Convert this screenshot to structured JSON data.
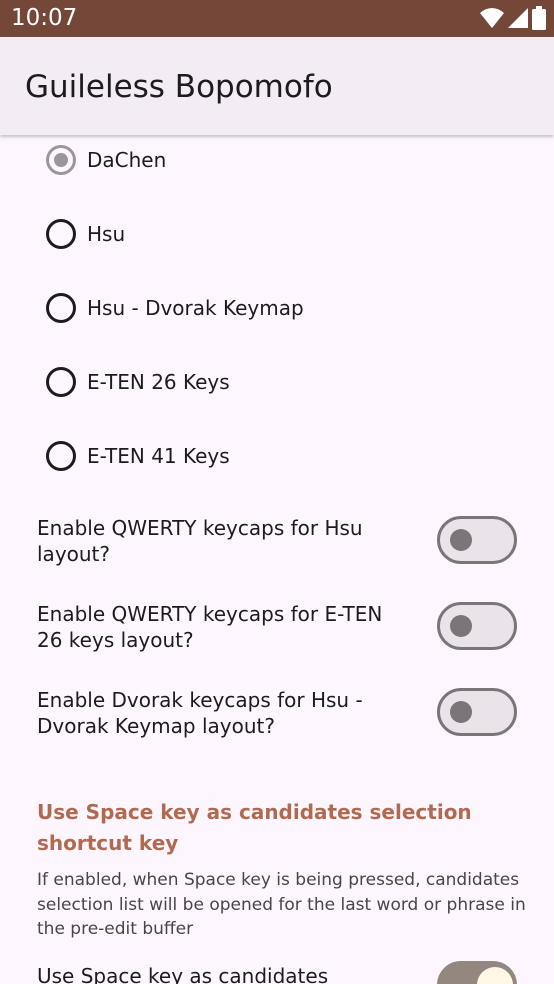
{
  "status_bar": {
    "time": "10:07",
    "icons": [
      "wifi-icon",
      "cellular-icon",
      "battery-icon"
    ]
  },
  "app_bar": {
    "title": "Guileless Bopomofo"
  },
  "keyboard_layouts": {
    "options": [
      {
        "label": "DaChen",
        "selected": true
      },
      {
        "label": "Hsu",
        "selected": false
      },
      {
        "label": "Hsu - Dvorak Keymap",
        "selected": false
      },
      {
        "label": "E-TEN 26 Keys",
        "selected": false
      },
      {
        "label": "E-TEN 41 Keys",
        "selected": false
      }
    ]
  },
  "switches": [
    {
      "label": "Enable QWERTY keycaps for Hsu layout?",
      "on": false
    },
    {
      "label": "Enable QWERTY keycaps for E-TEN 26 keys layout?",
      "on": false
    },
    {
      "label": "Enable Dvorak keycaps for Hsu - Dvorak Keymap layout?",
      "on": false
    }
  ],
  "space_key_section": {
    "title": "Use Space key as candidates selection shortcut key",
    "summary": "If enabled, when Space key is being pressed, candidates selection list will be opened for the last word or phrase in the pre-edit buffer",
    "switch_label": "Use Space key as candidates",
    "switch_on": true
  },
  "colors": {
    "status_bar": "#754738",
    "app_bar": "#f3ecf4",
    "background": "#fdf6ff",
    "accent": "#b06a50",
    "text": "#1e1b20"
  }
}
